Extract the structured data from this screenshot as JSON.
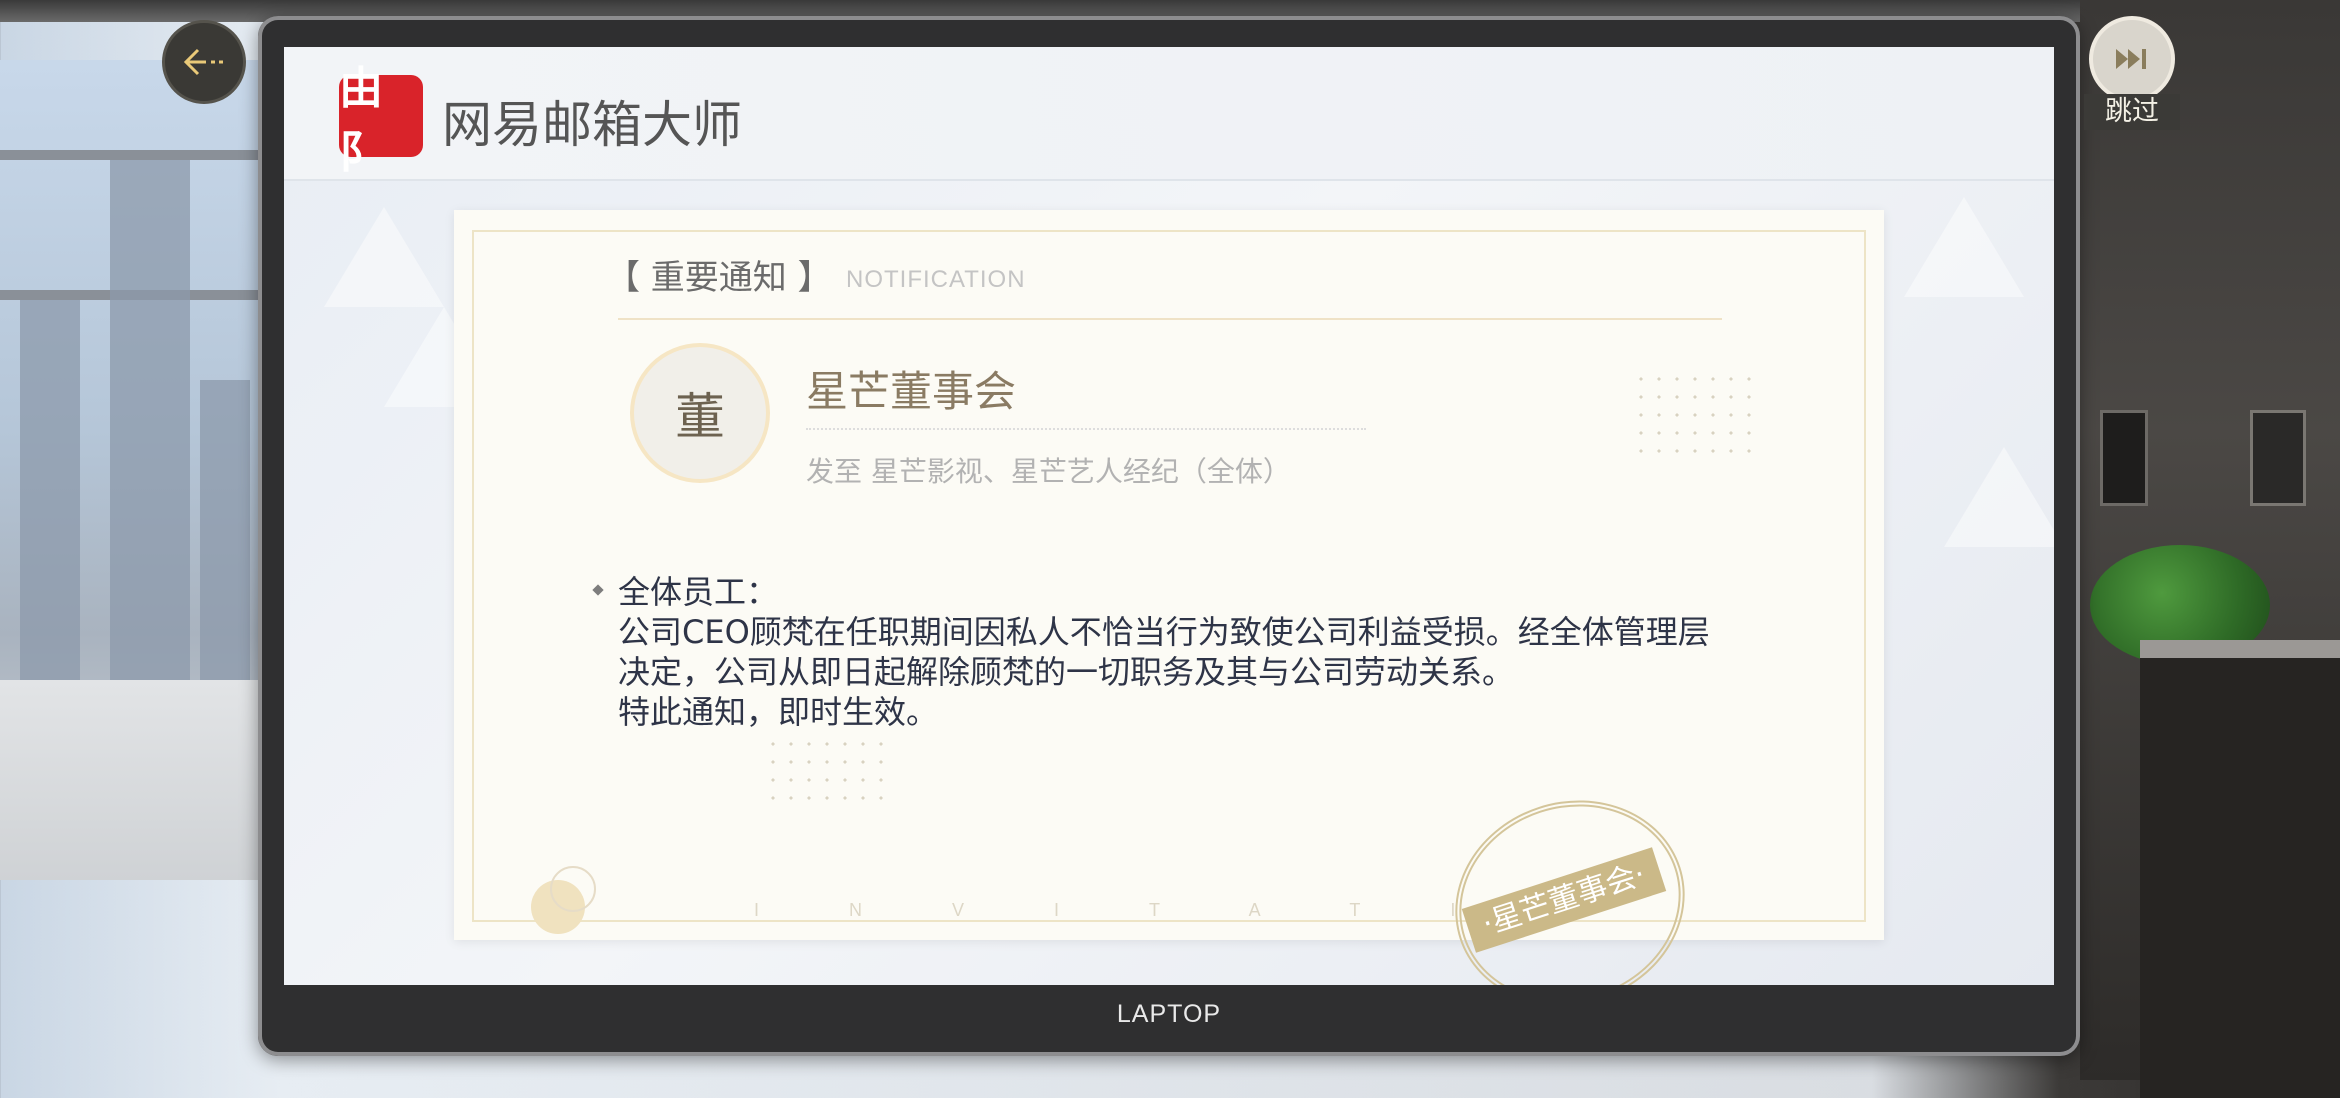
{
  "app": {
    "logo_text": "由阝",
    "title": "网易邮箱大师"
  },
  "notice": {
    "title": "【 重要通知 】",
    "subtitle": "NOTIFICATION"
  },
  "sender": {
    "avatar_char": "董",
    "name": "星芒董事会",
    "recipients": "发至  星芒影视、星芒艺人经纪（全体）"
  },
  "body": {
    "greeting": "全体员工：",
    "paragraph": "公司CEO顾梵在任职期间因私人不恰当行为致使公司利益受损。经全体管理层决定，公司从即日起解除顾梵的一切职务及其与公司劳动关系。",
    "closing": "特此通知，即时生效。"
  },
  "decor": {
    "invitation": "INVITATIO",
    "stamp": "·星芒董事会·"
  },
  "laptop": {
    "label": "LAPTOP"
  },
  "controls": {
    "back_icon": "back-arrow-icon",
    "skip_icon": "fast-forward-icon",
    "skip_label": "跳过"
  },
  "colors": {
    "logo_red": "#d9232a",
    "stamp_gold": "#cbb988",
    "body_text": "#2e3447"
  }
}
